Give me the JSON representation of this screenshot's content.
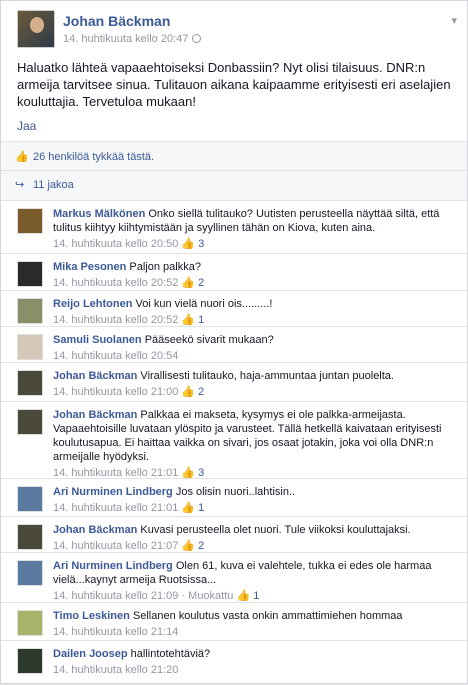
{
  "post": {
    "author": "Johan Bäckman",
    "time": "14. huhtikuuta kello 20:47",
    "text": "Haluatko lähteä vapaaehtoiseksi Donbassiin? Nyt olisi tilaisuus. DNR:n armeija tarvitsee sinua. Tulitauon aikana kaipaamme erityisesti eri aselajien kouluttajia. Tervetuloa mukaan!",
    "share_label": "Jaa",
    "likes_text": "26 henkilöä tykkää tästä.",
    "shares_text": "11 jakoa"
  },
  "comments": [
    {
      "name": "Markus Mälkönen",
      "text": "Onko siellä tulitauko? Uutisten perusteella näyttää siltä, että tulitus kiihtyy kiihtymistään ja syyllinen tähän on Kiova, kuten aina.",
      "time": "14. huhtikuuta kello 20:50",
      "likes": "3",
      "avatar": "#7a5b2c"
    },
    {
      "name": "Mika Pesonen",
      "text": "Paljon palkka?",
      "time": "14. huhtikuuta kello 20:52",
      "likes": "2",
      "avatar": "#2a2a2a"
    },
    {
      "name": "Reijo Lehtonen",
      "text": "Voi kun vielä nuori ois.........!",
      "time": "14. huhtikuuta kello 20:52",
      "likes": "1",
      "avatar": "#8a8f6a"
    },
    {
      "name": "Samuli Suolanen",
      "text": "Pääseekö sivarit mukaan?",
      "time": "14. huhtikuuta kello 20:54",
      "likes": "",
      "avatar": "#d6c8b8"
    },
    {
      "name": "Johan Bäckman",
      "text": "Virallisesti tulitauko, haja-ammuntaa juntan puolelta.",
      "time": "14. huhtikuuta kello 21:00",
      "likes": "2",
      "avatar": "#4b4a3a"
    },
    {
      "name": "Johan Bäckman",
      "text": "Palkkaa ei makseta, kysymys ei ole palkka-armeijasta. Vapaaehtoisille luvataan ylöspito ja varusteet. Tällä hetkellä kaivataan erityisesti koulutusapua. Ei haittaa vaikka on sivari, jos osaat jotakin, joka voi olla DNR:n armeijalle hyödyksi.",
      "time": "14. huhtikuuta kello 21:01",
      "likes": "3",
      "avatar": "#4b4a3a"
    },
    {
      "name": "Ari Nurminen Lindberg",
      "text": "Jos olisin nuori..lahtisin..",
      "time": "14. huhtikuuta kello 21:01",
      "likes": "1",
      "avatar": "#5a7aa0"
    },
    {
      "name": "Johan Bäckman",
      "text": "Kuvasi perusteella olet nuori. Tule viikoksi kouluttajaksi.",
      "time": "14. huhtikuuta kello 21:07",
      "likes": "2",
      "avatar": "#4b4a3a"
    },
    {
      "name": "Ari Nurminen Lindberg",
      "text": "Olen 61, kuva ei valehtele, tukka ei edes ole harmaa vielä...kaynyt armeija Ruotsissa...",
      "time": "14. huhtikuuta kello 21:09",
      "edited": "Muokattu",
      "likes": "1",
      "avatar": "#5a7aa0"
    },
    {
      "name": "Timo Leskinen",
      "text": "Sellanen koulutus vasta onkin ammattimiehen hommaa",
      "time": "14. huhtikuuta kello 21:14",
      "likes": "",
      "avatar": "#a7b56a"
    },
    {
      "name": "Dailen Joosep",
      "text": "hallintotehtäviä?",
      "time": "14. huhtikuuta kello 21:20",
      "likes": "",
      "avatar": "#2b3a2b"
    }
  ]
}
